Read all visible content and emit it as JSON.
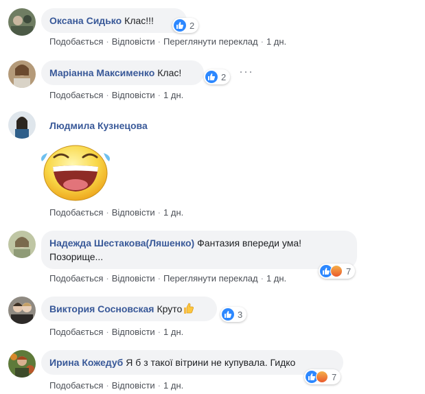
{
  "actions": {
    "like": "Подобається",
    "reply": "Відповісти",
    "translate": "Переглянути переклад"
  },
  "comments": [
    {
      "author": "Оксана Сидько",
      "text": "Клас!!!",
      "time": "1 дн.",
      "reactions": "2"
    },
    {
      "author": "Маріанна Максименко",
      "text": "Клас!",
      "time": "1 дн.",
      "reactions": "2"
    },
    {
      "author": "Людмила Кузнецова",
      "text": "",
      "time": "1 дн.",
      "sticker": "laughing-crying-emoji"
    },
    {
      "author": "Надежда Шестакова(Ляшенко)",
      "text_line1": "Фантазия впереди ума!",
      "text_line2": "Позорище...",
      "time": "1 дн.",
      "reactions": "7"
    },
    {
      "author": "Виктория Сосновская",
      "text": "Круто",
      "time": "1 дн.",
      "reactions": "3"
    },
    {
      "author": "Ирина Кожедуб",
      "text": "Я б з такої вітрини не купувала. Гидко",
      "time": "1 дн.",
      "reactions": "7"
    }
  ],
  "colors": {
    "author": "#385898",
    "like": "#2d88ff",
    "bubble": "#f2f3f5"
  }
}
